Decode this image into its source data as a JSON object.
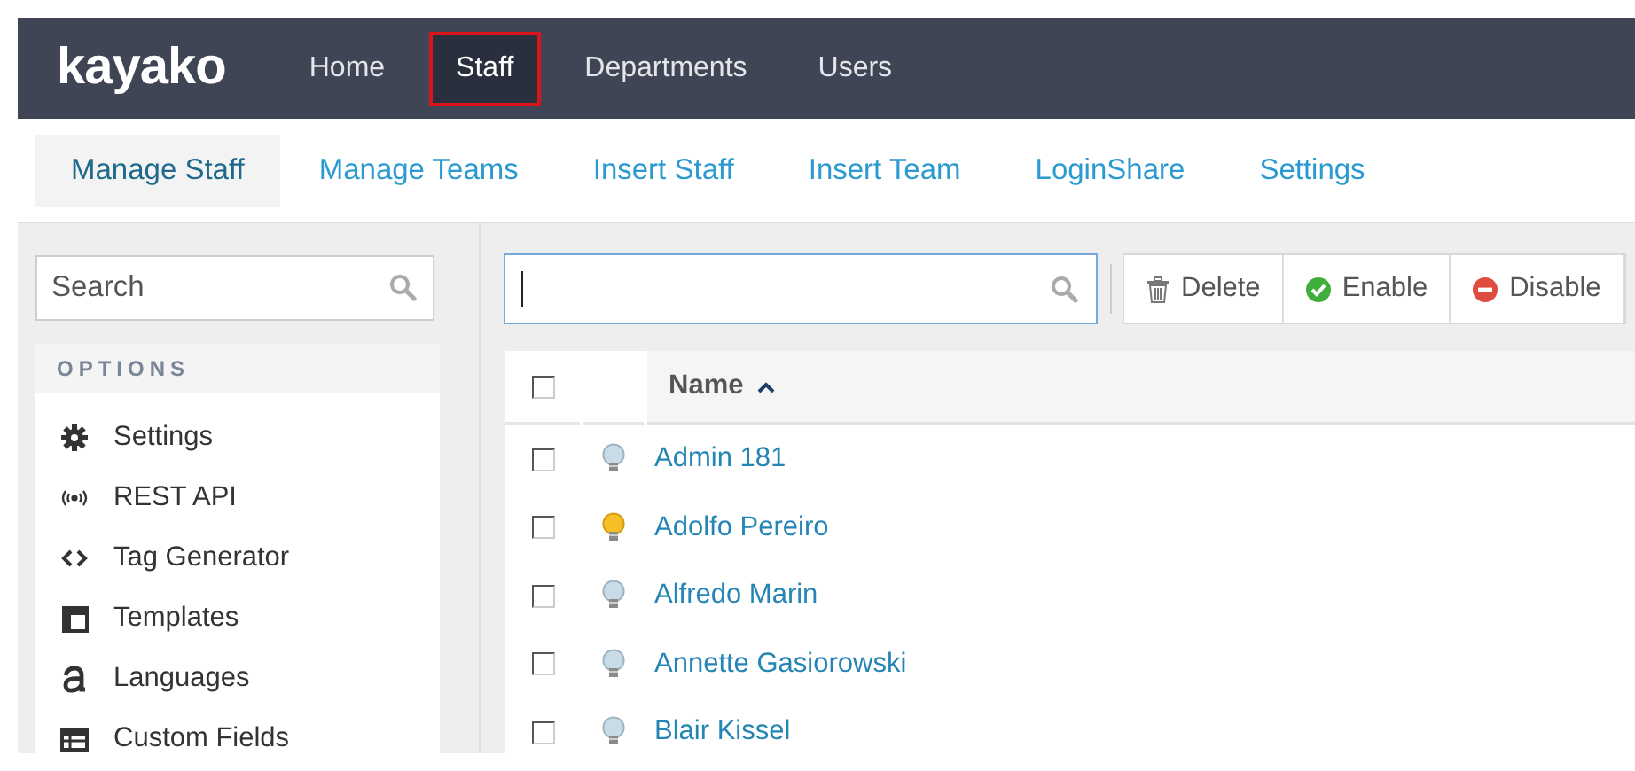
{
  "topbar": {
    "logo": "kayako",
    "tabs": [
      {
        "label": "Home",
        "selected": false
      },
      {
        "label": "Staff",
        "selected": true
      },
      {
        "label": "Departments",
        "selected": false
      },
      {
        "label": "Users",
        "selected": false
      }
    ]
  },
  "subnav": {
    "items": [
      {
        "label": "Manage Staff",
        "selected": true
      },
      {
        "label": "Manage Teams",
        "selected": false
      },
      {
        "label": "Insert Staff",
        "selected": false
      },
      {
        "label": "Insert Team",
        "selected": false
      },
      {
        "label": "LoginShare",
        "selected": false
      },
      {
        "label": "Settings",
        "selected": false
      }
    ]
  },
  "sidebar": {
    "search": {
      "placeholder": "Search"
    },
    "heading": "OPTIONS",
    "items": [
      {
        "label": "Settings"
      },
      {
        "label": "REST API"
      },
      {
        "label": "Tag Generator"
      },
      {
        "label": "Templates"
      },
      {
        "label": "Languages"
      },
      {
        "label": "Custom Fields"
      }
    ]
  },
  "toolbar": {
    "buttons": [
      {
        "label": "Delete",
        "kind": "delete"
      },
      {
        "label": "Enable",
        "kind": "enable"
      },
      {
        "label": "Disable",
        "kind": "disable"
      }
    ]
  },
  "table": {
    "header_checked": false,
    "columns": [
      {
        "label": "Name",
        "sorted_ascending": true
      }
    ],
    "rows": [
      {
        "name": "Admin 181",
        "checked": false,
        "online": false
      },
      {
        "name": "Adolfo Pereiro",
        "checked": false,
        "online": true
      },
      {
        "name": "Alfredo Marin",
        "checked": false,
        "online": false
      },
      {
        "name": "Annette Gasiorowski",
        "checked": false,
        "online": false
      },
      {
        "name": "Blair Kissel",
        "checked": false,
        "online": false
      }
    ]
  }
}
